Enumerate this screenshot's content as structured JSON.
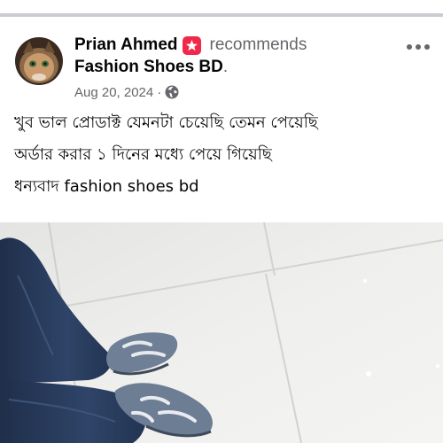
{
  "post": {
    "author": "Prian Ahmed",
    "action": "recommends",
    "page": "Fashion Shoes BD",
    "page_suffix": ".",
    "date": "Aug 20, 2024",
    "separator": "·",
    "audience_icon": "globe-icon",
    "recommend_icon": "recommend-badge-icon",
    "more_icon": "more-options-icon",
    "body_lines": [
      "খুব ভাল প্রোডাক্ট যেমনটা চেয়েছি তেমন পেয়েছি",
      "অর্ডার করার ১ দিনের মধ্যে পেয়ে গিয়েছি",
      "ধন্যবাদ fashion shoes bd"
    ]
  },
  "colors": {
    "text_primary": "#050505",
    "text_secondary": "#65676b",
    "recommend_badge": "#f02849",
    "divider": "#c9ccd1"
  }
}
